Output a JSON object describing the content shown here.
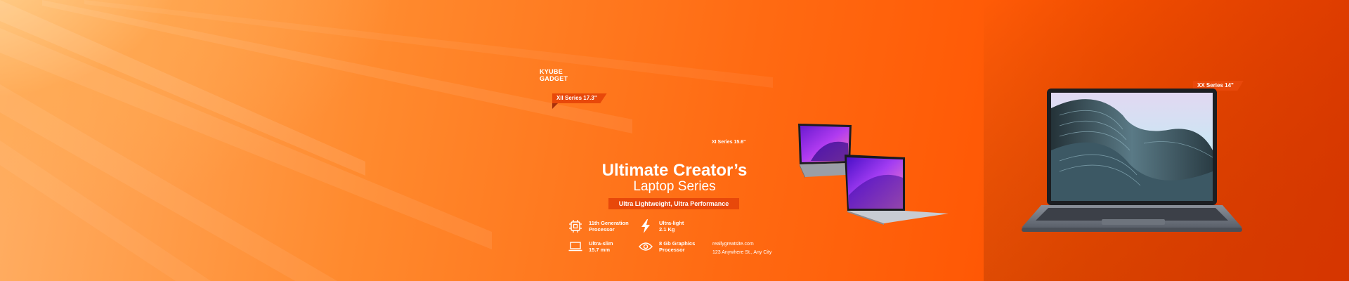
{
  "brand": {
    "line1": "KYUBE",
    "line2": "GADGET"
  },
  "tags": {
    "xii": "XII Series 17.3\"",
    "xi": "XI Series 15.6\"",
    "xx": "XX Series 14\""
  },
  "headline": {
    "line1": "Ultimate Creator’s",
    "line2": "Laptop Series"
  },
  "tagline": "Ultra Lightweight, Ultra Performance",
  "features": [
    {
      "icon": "cpu-chip-icon",
      "line1": "11th Generation",
      "line2": "Processor"
    },
    {
      "icon": "lightning-bolt-icon",
      "line1": "Ultra-light",
      "line2": "2.1 Kg"
    },
    {
      "icon": "laptop-icon",
      "line1": "Ultra-slim",
      "line2": "15.7 mm"
    },
    {
      "icon": "eye-icon",
      "line1": "8 Gb Graphics",
      "line2": "Processor"
    }
  ],
  "contact": {
    "email": "reallygreatsite.com",
    "address": "123 Anywhere St., Any City"
  },
  "colors": {
    "accent": "#e8480a",
    "orange_dark": "#ff4400",
    "orange_light": "#ffb066"
  }
}
